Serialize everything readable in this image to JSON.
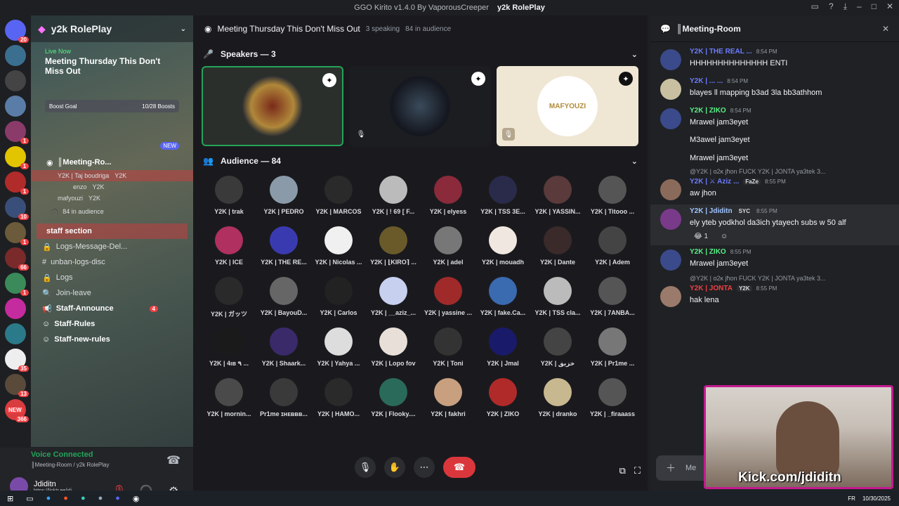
{
  "window": {
    "title_app": "GGO Kirito v1.4.0 By VaporousCreeper",
    "title_server": "y2k RolePlay"
  },
  "servers": {
    "badges": [
      "20",
      "1",
      "1",
      "1",
      "10",
      "1",
      "66",
      "1",
      "35",
      "13",
      "NEW",
      "366"
    ]
  },
  "sidebar": {
    "guild_name": "y2k RolePlay",
    "live": {
      "tag": "Live Now",
      "title": "Meeting Thursday This Don't Miss Out"
    },
    "boost": {
      "label": "Boost Goal",
      "value": "10/28 Boosts"
    },
    "new_badge": "NEW",
    "voice_channel": "║Meeting-Ro...",
    "voice_members": [
      "Y2K | Taj boudriga",
      "enzo",
      "mafyouzi"
    ],
    "member_tag": "Y2K",
    "audience": "84 in audience",
    "section": "staff section",
    "channels": [
      {
        "label": "Logs-Message-Del...",
        "count": ""
      },
      {
        "label": "unban-logs-disc",
        "count": ""
      },
      {
        "label": "Logs",
        "count": ""
      },
      {
        "label": "Join-leave",
        "count": ""
      },
      {
        "label": "Staff-Announce",
        "count": "4"
      },
      {
        "label": "Staff-Rules",
        "count": ""
      },
      {
        "label": "Staff-new-rules",
        "count": ""
      }
    ]
  },
  "voice": {
    "status": "Voice Connected",
    "location": "║Meeting-Room / y2k RolePlay",
    "username": "Jdiditn",
    "user_sub": "https://linktr.ee/jdi..."
  },
  "stage": {
    "title": "Meeting Thursday This Don't Miss Out",
    "speaking": "3 speaking",
    "audience_count": "84 in audience",
    "speakers_header": "Speakers — 3",
    "audience_header": "Audience — 84",
    "speaker_tile_label": "MAFYOUZI",
    "audience": [
      "Y2K | trak",
      "Y2K | PEDRO",
      "Y2K | MARCOS",
      "Y2K | ! 69 [ F...",
      "Y2K | elyess",
      "Y2K | TSS 3E...",
      "Y2K | YASSIN...",
      "Y2K | Titooo ...",
      "Y2K | ICE",
      "Y2K | THE RE...",
      "Y2K | Nicolas ...",
      "Y2K | ⌊KIRO⌉ ...",
      "Y2K | adel",
      "Y2K | mouadh",
      "Y2K | Dante",
      "Y2K | Adem",
      "Y2K | ガッツ",
      "Y2K | BayouD...",
      "Y2K | Carlos",
      "Y2K | __aziz_...",
      "Y2K | yassine ...",
      "Y2K | fake.Ca...",
      "Y2K | TSS cla...",
      "Y2K | 7ANBA...",
      "Y2K | 4ıв ٩ ...",
      "Y2K | Shaark...",
      "Y2K | Yahya ...",
      "Y2K | Lopo fov",
      "Y2K | Toni",
      "Y2K | Jmal",
      "Y2K | خزيق",
      "Y2K | Pr1me ...",
      "Y2K | mornin...",
      "Pr1me ɪʜᴇʙʙʙ...",
      "Y2K | HAMO...",
      "Y2K | Flooky....",
      "Y2K | fakhri",
      "Y2K | ZIKO",
      "Y2K | dranko",
      "Y2K | _firaaass"
    ]
  },
  "chat": {
    "title": "║Meeting-Room",
    "messages": [
      {
        "author": "Y2K | THE REAL ...",
        "time": "8:54 PM",
        "lines": [
          "HHHHHHHHHHHHHH ENTI"
        ],
        "color": "#6b7cff"
      },
      {
        "author": "Y2K | ... ...",
        "time": "8:54 PM",
        "lines": [
          "blayes ll mapping b3ad  3la bb3athhom"
        ],
        "color": "#6b7cff"
      },
      {
        "author": "Y2K | ZIKO",
        "time": "8:54 PM",
        "lines": [
          "Mrawel jam3eyet",
          "M3awel jam3eyet",
          "Mrawel jam3eyet"
        ],
        "color": "#57f287"
      },
      {
        "reply": "@Y2K | ɑ2κ jħon  FUCK  Y2K | JONTA  ya3tek 3...",
        "author": "Y2K | ⚔ Aziz ...",
        "tag": "FaZe",
        "time": "8:55 PM",
        "lines": [
          "aw jhon"
        ],
        "color": "#6b7cff"
      },
      {
        "author": "Y2K | Jdiditn",
        "tag": "SYC",
        "time": "8:55 PM",
        "lines": [
          "ely yteb yodkhol da3ich ytayech subs w 50 alf"
        ],
        "reaction": "1",
        "color": "#a0c4ff"
      },
      {
        "author": "Y2K | ZIKO",
        "time": "8:55 PM",
        "lines": [
          "Mrawel jam3eyet"
        ],
        "color": "#57f287"
      },
      {
        "reply": "@Y2K | ɑ2κ jħon  FUCK  Y2K | JONTA  ya3tek 3...",
        "author": "Y2K | JONTA",
        "tag": "Y2K",
        "time": "8:55 PM",
        "lines": [
          "hak lena"
        ],
        "color": "#f23f43"
      }
    ],
    "input_placeholder": "Me"
  },
  "webcam": {
    "overlay": "Kick.com/jdiditn"
  },
  "taskbar": {
    "lang": "FR",
    "date": "10/30/2025"
  },
  "colors": {
    "accent": "#5865f2",
    "green": "#23a55a",
    "red": "#da373c",
    "overlay_border": "#c31b8f"
  }
}
